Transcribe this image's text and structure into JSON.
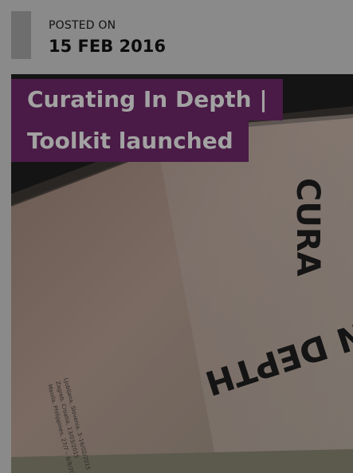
{
  "post": {
    "posted_on_label": "POSTED ON",
    "date": "15 FEB 2016",
    "title_line_1": "Curating In Depth |",
    "title_line_2": "Toolkit launched"
  },
  "image": {
    "cover_text_top": "CURA",
    "cover_text_main": "IN DEPTH",
    "cover_small_1": "Ljubljana, Slovenia, 3–16/02/2015",
    "cover_small_2": "Zagreb, Croatia, 13/03/2015",
    "cover_small_3": "Manila, Philippines, 27/7 – 8/8/2015"
  },
  "colors": {
    "overlay": "#4a1b46",
    "title_text": "#a2a2a2",
    "background": "#8a8a8a"
  }
}
